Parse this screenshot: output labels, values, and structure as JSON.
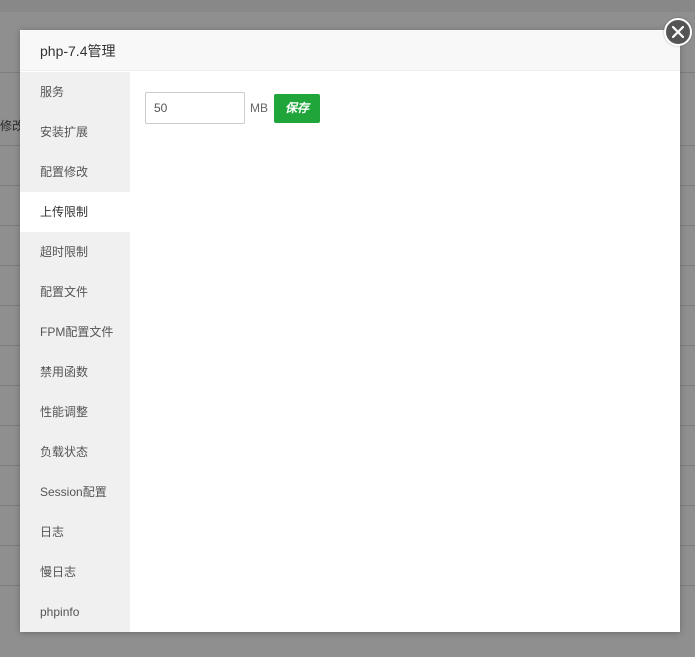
{
  "background": {
    "partial_text": "修改"
  },
  "modal": {
    "title": "php-7.4管理"
  },
  "sidebar": {
    "items": [
      {
        "label": "服务",
        "active": false
      },
      {
        "label": "安装扩展",
        "active": false
      },
      {
        "label": "配置修改",
        "active": false
      },
      {
        "label": "上传限制",
        "active": true
      },
      {
        "label": "超时限制",
        "active": false
      },
      {
        "label": "配置文件",
        "active": false
      },
      {
        "label": "FPM配置文件",
        "active": false
      },
      {
        "label": "禁用函数",
        "active": false
      },
      {
        "label": "性能调整",
        "active": false
      },
      {
        "label": "负载状态",
        "active": false
      },
      {
        "label": "Session配置",
        "active": false
      },
      {
        "label": "日志",
        "active": false
      },
      {
        "label": "慢日志",
        "active": false
      },
      {
        "label": "phpinfo",
        "active": false
      }
    ]
  },
  "upload_limit": {
    "value": "50",
    "unit": "MB",
    "save_label": "保存"
  },
  "colors": {
    "accent_green": "#20a53a",
    "sidebar_bg": "#f0f0f0",
    "close_button": "#555555"
  },
  "icons": {
    "close": "close-icon"
  }
}
